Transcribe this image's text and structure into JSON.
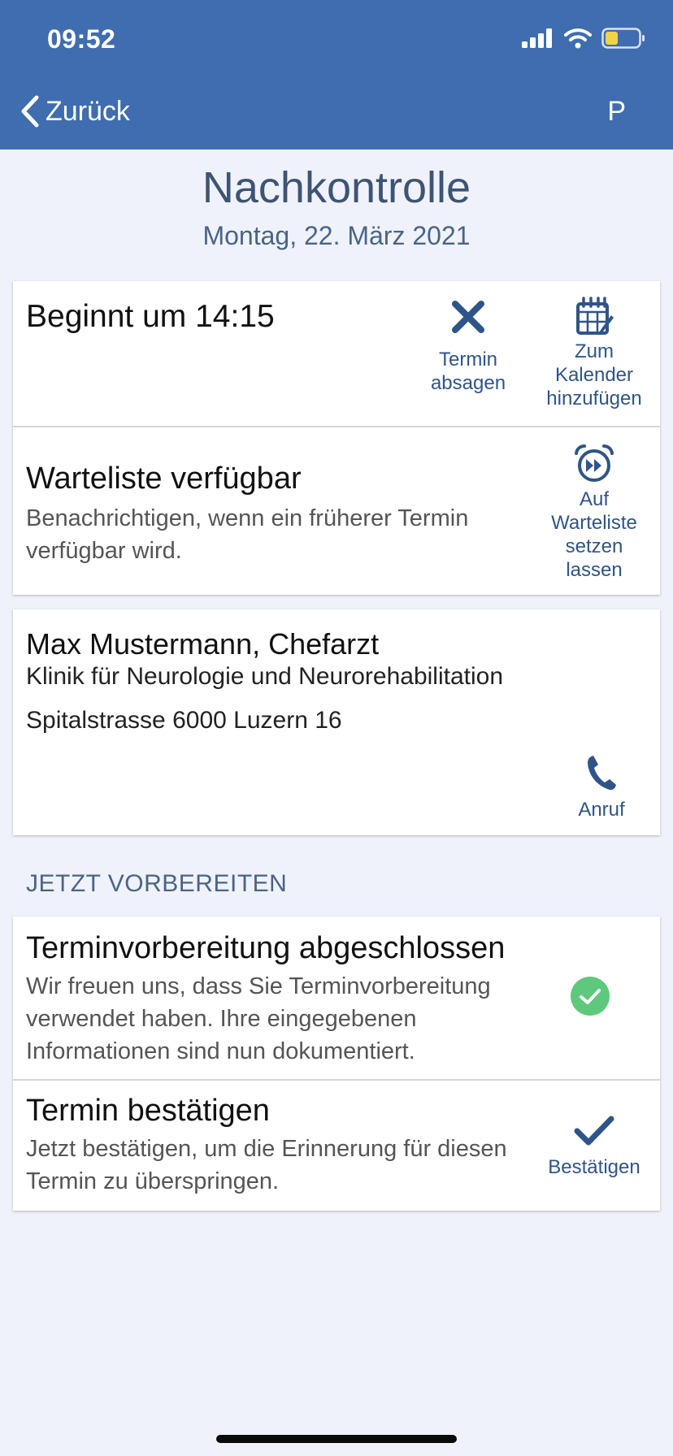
{
  "status_bar": {
    "time": "09:52"
  },
  "nav": {
    "back_label": "Zurück",
    "profile_initial": "P"
  },
  "appointment": {
    "title": "Nachkontrolle",
    "date": "Montag, 22. März 2021"
  },
  "start_card": {
    "start_text": "Beginnt um 14:15",
    "cancel_label": "Termin absagen",
    "calendar_label": "Zum Kalender hinzufügen"
  },
  "waitlist": {
    "title": "Warteliste verfügbar",
    "description": "Benachrichtigen, wenn ein früherer Termin verfügbar wird.",
    "action_label": "Auf Warteliste setzen lassen"
  },
  "doctor": {
    "name": "Max Mustermann, Chefarzt",
    "clinic": "Klinik für Neurologie und Neurorehabilitation",
    "address": "Spitalstrasse 6000 Luzern 16",
    "call_label": "Anruf"
  },
  "prepare": {
    "section_label": "JETZT VORBEREITEN",
    "done_title": "Terminvorbereitung abgeschlossen",
    "done_text": "Wir freuen uns, dass Sie Terminvorbereitung verwendet haben. Ihre eingegebenen Informationen sind nun dokumentiert.",
    "confirm_title": "Termin bestätigen",
    "confirm_text": "Jetzt bestätigen, um die Erinnerung für diesen Termin zu überspringen.",
    "confirm_label": "Bestätigen"
  },
  "colors": {
    "header": "#3f6daf",
    "accent": "#2f5588",
    "success": "#5ec97c"
  }
}
